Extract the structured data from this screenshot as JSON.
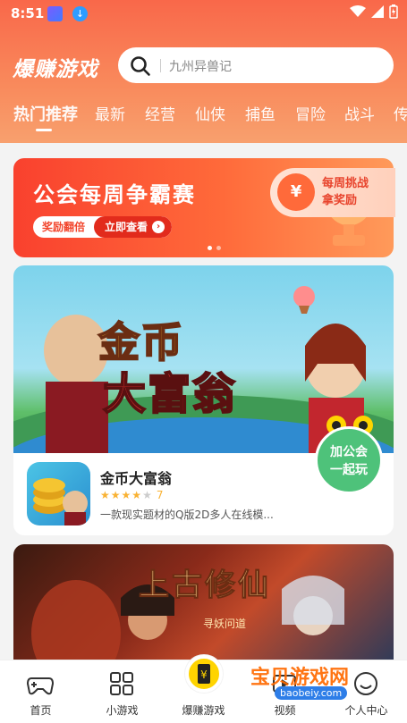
{
  "status_bar": {
    "time": "8:51"
  },
  "header": {
    "brand": "爆赚游戏",
    "search": {
      "placeholder": "九州异兽记"
    }
  },
  "tabs": [
    "热门推荐",
    "最新",
    "经营",
    "仙侠",
    "捕鱼",
    "冒险",
    "战斗",
    "传"
  ],
  "active_tab": "热门推荐",
  "banner": {
    "title": "公会每周争霸赛",
    "pill_left": "奖励翻倍",
    "pill_right": "立即查看",
    "dots_count": 2,
    "active_dot": 0
  },
  "featured": {
    "hero_line1": "金币",
    "hero_line2": "大富翁",
    "name": "金币大富翁",
    "rating": "7",
    "stars_filled": 3.5,
    "stars_total": 5,
    "description": "一款现实题材的Q版2D多人在线模..."
  },
  "challenge": {
    "line1": "每周挑战",
    "line2": "拿奖励",
    "icon_text": "¥"
  },
  "second_card": {
    "title": "上古修仙",
    "subtitle": "寻妖问道"
  },
  "join_bubble": {
    "line1": "加公会",
    "line2": "一起玩"
  },
  "tabbar": {
    "items": [
      {
        "label": "首页",
        "icon": "gamepad-icon"
      },
      {
        "label": "小游戏",
        "icon": "grid-icon"
      },
      {
        "label": "爆赚游戏",
        "icon": "yen-ticket-icon"
      },
      {
        "label": "视频",
        "icon": "video-icon"
      },
      {
        "label": "个人中心",
        "icon": "profile-icon"
      }
    ]
  },
  "watermark": {
    "text": "宝贝游戏网",
    "sub": "baobeiy.com"
  },
  "colors": {
    "header": "#f9684a",
    "accent": "#e22b1c",
    "tab_center": "#ffd400"
  }
}
